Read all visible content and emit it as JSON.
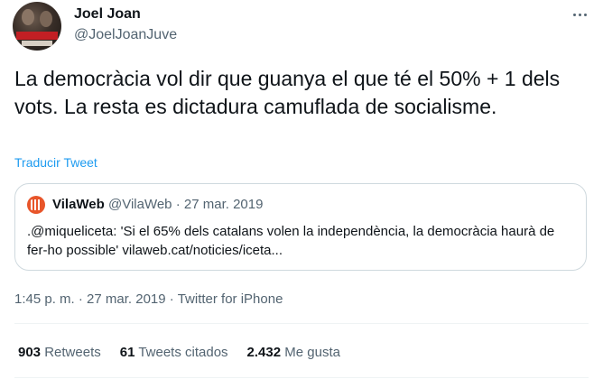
{
  "author": {
    "name": "Joel Joan",
    "handle": "@JoelJoanJuve"
  },
  "tweet": {
    "text": "La democràcia vol dir que guanya el que té el 50% + 1 dels vots. La resta es dictadura camuflada de socialisme.",
    "translate_label": "Traducir Tweet"
  },
  "quote": {
    "name": "VilaWeb",
    "handle": "@VilaWeb",
    "separator": "·",
    "date": "27 mar. 2019",
    "text": ".@miqueliceta: 'Si el 65% dels catalans volen la independència, la democràcia haurà de fer-ho possible' vilaweb.cat/noticies/iceta..."
  },
  "meta": {
    "time": "1:45 p. m.",
    "separator1": "·",
    "date": "27 mar. 2019",
    "separator2": "·",
    "source": "Twitter for iPhone"
  },
  "stats": [
    {
      "value": "903",
      "label": "Retweets"
    },
    {
      "value": "61",
      "label": "Tweets citados"
    },
    {
      "value": "2.432",
      "label": "Me gusta"
    }
  ],
  "icons": {
    "more": "more-horizontal-icon",
    "quote_avatar": "vilaweb-logo"
  },
  "colors": {
    "link": "#1d9bf0",
    "secondary_text": "#536471",
    "border": "#cfd9de",
    "vilaweb_brand": "#e8552a"
  }
}
